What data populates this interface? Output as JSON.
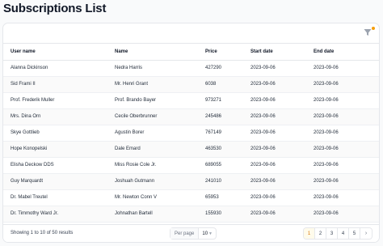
{
  "page": {
    "title": "Subscriptions List"
  },
  "table": {
    "columns": [
      "User name",
      "Name",
      "Price",
      "Start date",
      "End date"
    ],
    "rows": [
      [
        "Alanna Dickinson",
        "Nedra Harris",
        "427290",
        "2023-09-06",
        "2023-09-06"
      ],
      [
        "Sid Frami II",
        "Mr. Henri Grant",
        "6038",
        "2023-09-06",
        "2023-09-06"
      ],
      [
        "Prof. Frederik Muller",
        "Prof. Brando Bayer",
        "973271",
        "2023-09-06",
        "2023-09-06"
      ],
      [
        "Mrs. Dina Orn",
        "Cecile Oberbrunner",
        "245486",
        "2023-09-06",
        "2023-09-06"
      ],
      [
        "Skye Gottlieb",
        "Agustin Borer",
        "767149",
        "2023-09-06",
        "2023-09-06"
      ],
      [
        "Hope Konopelski",
        "Dale Emard",
        "463530",
        "2023-09-06",
        "2023-09-06"
      ],
      [
        "Elisha Deckow DDS",
        "Miss Rosie Cole Jr.",
        "689055",
        "2023-09-06",
        "2023-09-06"
      ],
      [
        "Guy Marquardt",
        "Joshuah Gutmann",
        "241010",
        "2023-09-06",
        "2023-09-06"
      ],
      [
        "Dr. Mabel Treutel",
        "Mr. Newton Conn V",
        "65953",
        "2023-09-06",
        "2023-09-06"
      ],
      [
        "Dr. Timmothy Ward Jr.",
        "Johnathan Bartell",
        "155930",
        "2023-09-06",
        "2023-09-06"
      ]
    ]
  },
  "footer": {
    "results_text": "Showing 1 to 10 of 50 results",
    "per_page_label": "Per page",
    "per_page_value": "10",
    "pages": [
      "1",
      "2",
      "3",
      "4",
      "5"
    ],
    "active_page": "1",
    "next_label": "›"
  },
  "icons": {
    "filter": "filter-icon",
    "next": "chevron-right-icon",
    "select": "chevron-down-icon"
  },
  "colors": {
    "accent": "#f59e0b",
    "active_page": "#d97706"
  }
}
